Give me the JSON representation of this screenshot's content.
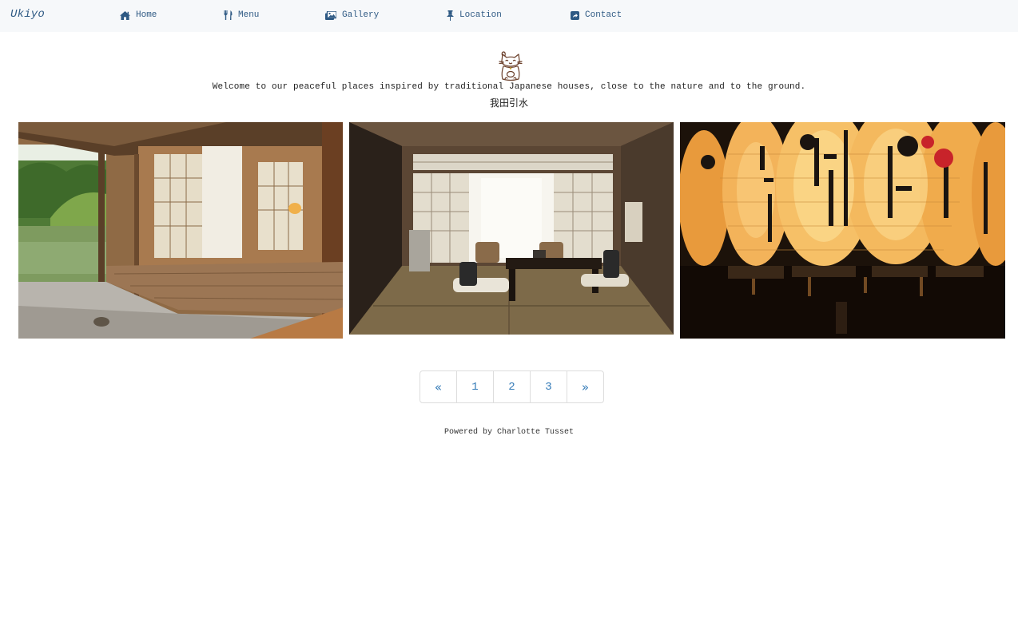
{
  "navbar": {
    "brand": "Ukiyo",
    "links": [
      {
        "label": "Home",
        "icon": "home-icon"
      },
      {
        "label": "Menu",
        "icon": "cutlery-icon"
      },
      {
        "label": "Gallery",
        "icon": "images-icon"
      },
      {
        "label": "Location",
        "icon": "pushpin-icon"
      },
      {
        "label": "Contact",
        "icon": "share-square-icon"
      }
    ]
  },
  "hero": {
    "logo": "maneki-neko-cat-logo",
    "tagline": "Welcome to our peaceful places inspired by traditional Japanese houses, close to the nature and to the ground.",
    "kanji": "我田引水"
  },
  "gallery": {
    "photos": [
      {
        "subject": "engawa veranda overlooking pond and garden"
      },
      {
        "subject": "tatami room with low table and shoji windows"
      },
      {
        "subject": "illuminated paper lanterns at night"
      }
    ]
  },
  "pagination": {
    "prev": "«",
    "pages": [
      "1",
      "2",
      "3"
    ],
    "next": "»"
  },
  "footer": {
    "prefix": "Powered by",
    "author": "Charlotte Tusset"
  },
  "colors": {
    "navbar_bg": "#f6f8fa",
    "link": "#2f5a84",
    "pagination_link": "#337ab7",
    "border": "#dddddd"
  }
}
